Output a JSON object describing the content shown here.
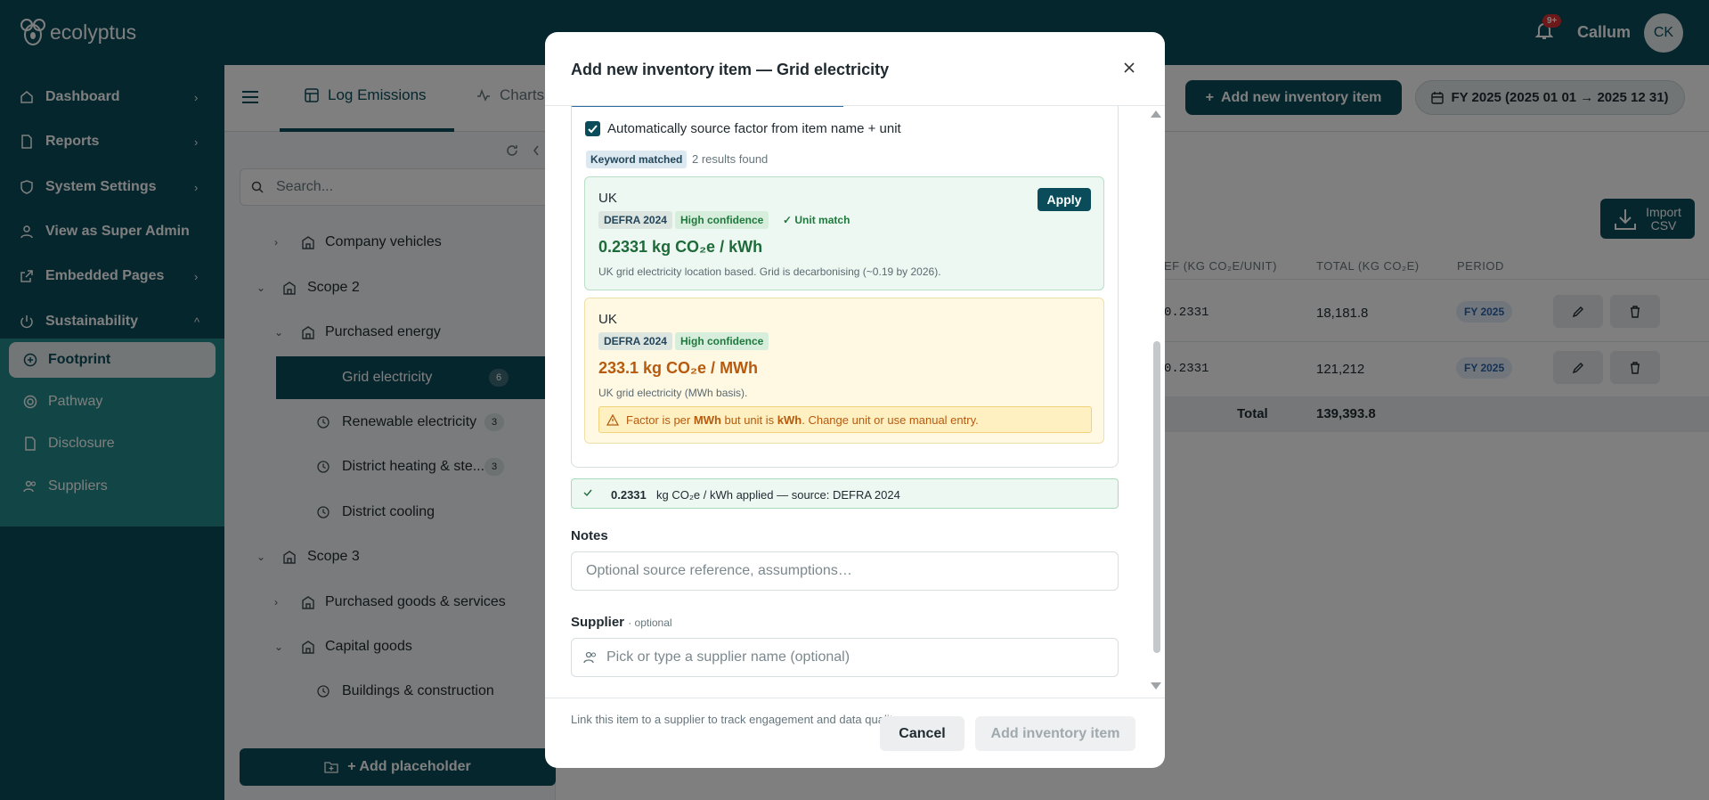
{
  "app": {
    "name": "ecolyptus",
    "notifications": "9+",
    "user_name": "Callum",
    "user_initials": "CK"
  },
  "sidebar": {
    "items": [
      {
        "label": "Dashboard",
        "chev": "›"
      },
      {
        "label": "Reports",
        "chev": "›"
      },
      {
        "label": "System Settings",
        "chev": "›"
      },
      {
        "label": "View as Super Admin",
        "chev": ""
      },
      {
        "label": "Embedded Pages",
        "chev": "›"
      },
      {
        "label": "Sustainability",
        "chev": "^"
      }
    ],
    "sub_items": [
      "Footprint",
      "Pathway",
      "Disclosure",
      "Suppliers"
    ]
  },
  "header": {
    "tab_log": "Log Emissions",
    "tab_charts": "Charts",
    "add_button": "Add new inventory item",
    "fy_button": "FY 2025 (2025 01 01 → 2025 12 31)"
  },
  "tree": {
    "search_placeholder": "Search...",
    "rows": [
      "Company vehicles",
      "Scope 2",
      "Purchased energy",
      "Grid electricity",
      "Renewable electricity",
      "District heating & ste...",
      "District cooling",
      "Scope 3",
      "Purchased goods & services",
      "Capital goods",
      "Buildings & construction"
    ],
    "counts": {
      "grid": "6",
      "renewable": "3",
      "district": "3"
    },
    "add_placeholder": "+ Add placeholder"
  },
  "table": {
    "import_label_1": "Import",
    "import_label_2": "CSV",
    "headers": [
      "EF (KG CO₂E/UNIT)",
      "TOTAL (KG CO₂E)",
      "PERIOD"
    ],
    "rows": [
      {
        "ef": "0.2331",
        "total": "18,181.8",
        "period": "FY 2025"
      },
      {
        "ef": "0.2331",
        "total": "121,212",
        "period": "FY 2025"
      }
    ],
    "total_label": "Total",
    "total_value": "139,393.8"
  },
  "modal": {
    "title": "Add new inventory item — Grid electricity",
    "auto_source_label": "Automatically source factor from item name + unit",
    "keyword_badge": "Keyword matched",
    "results": "2 results found",
    "card1": {
      "country": "UK",
      "src": "DEFRA 2024",
      "conf": "High confidence",
      "match": "✓ Unit match",
      "value": "0.2331 kg CO₂e / kWh",
      "desc": "UK grid electricity location based. Grid is decarbonising (~0.19 by 2026).",
      "apply": "Apply"
    },
    "card2": {
      "country": "UK",
      "src": "DEFRA 2024",
      "conf": "High confidence",
      "value": "233.1 kg CO₂e / MWh",
      "desc": "UK grid electricity (MWh basis).",
      "warn_pre": "Factor is per ",
      "warn_b1": "MWh",
      "warn_mid": " but unit is ",
      "warn_b2": "kWh",
      "warn_post": ". Change unit or use manual entry."
    },
    "applied_value": "0.2331",
    "applied_text": "kg CO₂e / kWh applied — source: DEFRA 2024",
    "notes_label": "Notes",
    "notes_placeholder": "Optional source reference, assumptions…",
    "supplier_label": "Supplier",
    "supplier_optional": "· optional",
    "supplier_placeholder": "Pick or type a supplier name (optional)",
    "supplier_hint": "Link this item to a supplier to track engagement and data quality.",
    "cancel": "Cancel",
    "submit": "Add inventory item"
  }
}
